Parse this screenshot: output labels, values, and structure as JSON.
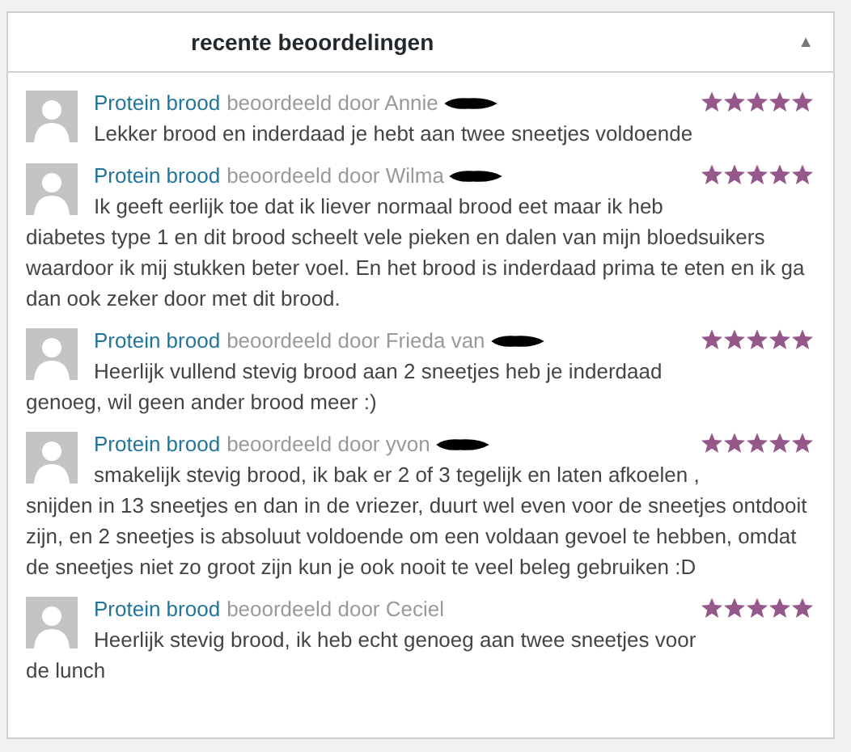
{
  "widget": {
    "title": "recente beoordelingen",
    "collapse_icon": "▲",
    "expanded": true
  },
  "reviews": [
    {
      "product": "Protein brood",
      "by": "beoordeeld door Annie",
      "redacted": true,
      "stars": 5,
      "text": "Lekker brood en inderdaad je hebt aan twee sneetjes voldoende"
    },
    {
      "product": "Protein brood",
      "by": "beoordeeld door Wilma",
      "redacted": true,
      "stars": 5,
      "text": "Ik geeft eerlijk toe dat ik liever normaal brood eet maar ik heb diabetes type 1 en dit brood scheelt vele pieken en dalen van mijn bloedsuikers waardoor ik mij stukken beter voel. En het brood is inderdaad prima te eten en ik ga dan ook zeker door met dit brood."
    },
    {
      "product": "Protein brood",
      "by": "beoordeeld door Frieda van",
      "redacted": true,
      "stars": 5,
      "text": "Heerlijk vullend stevig brood aan 2 sneetjes heb je inderdaad genoeg, wil geen ander brood meer :)"
    },
    {
      "product": "Protein brood",
      "by": "beoordeeld door yvon",
      "redacted": true,
      "stars": 5,
      "text": "smakelijk stevig brood, ik bak er 2 of 3 tegelijk en laten afkoelen , snijden in 13 sneetjes en dan in de vriezer, duurt wel even voor de sneetjes ontdooit zijn, en 2 sneetjes is absoluut voldoende om een voldaan gevoel te hebben, omdat de sneetjes niet zo groot zijn kun je ook nooit te veel beleg gebruiken :D"
    },
    {
      "product": "Protein brood",
      "by": "beoordeeld door Ceciel",
      "redacted": false,
      "stars": 5,
      "text": "Heerlijk stevig brood, ik heb echt genoeg aan twee sneetjes voor de lunch"
    }
  ]
}
